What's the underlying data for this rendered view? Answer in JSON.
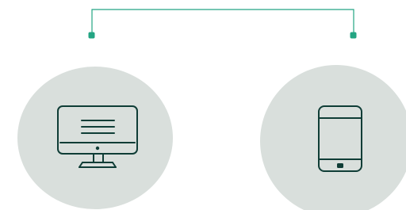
{
  "colors": {
    "background": "#ffffff",
    "accent": "#23a583",
    "icon_stroke": "#0f3d36",
    "circle_fill": "#d9dfdc"
  },
  "nodes": [
    {
      "icon": "desktop-monitor-icon"
    },
    {
      "icon": "smartphone-icon"
    }
  ]
}
